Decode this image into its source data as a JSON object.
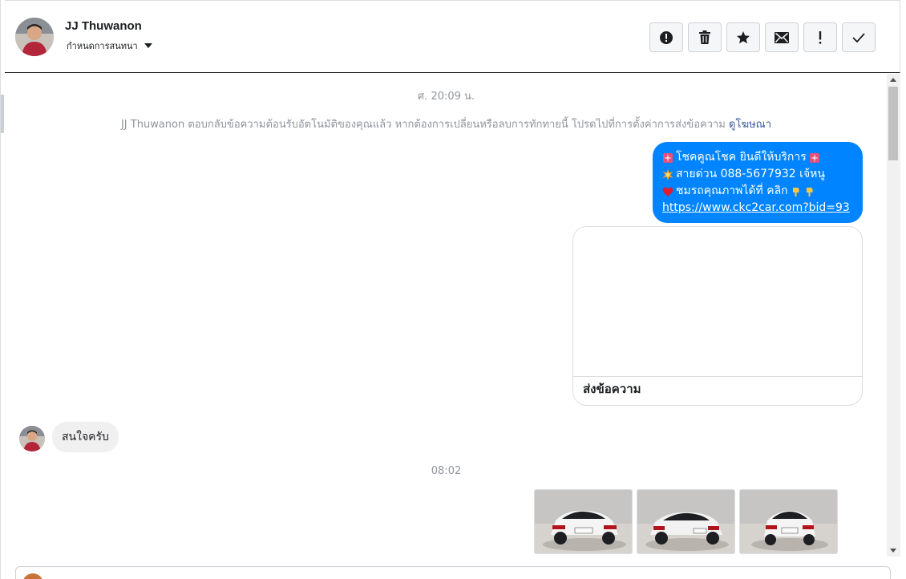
{
  "header": {
    "name": "JJ Thuwanon",
    "subtitle": "กำหนดการสนทนา"
  },
  "toolbar": {
    "buttons": [
      {
        "icon": "alert-circle-icon"
      },
      {
        "icon": "trash-icon"
      },
      {
        "icon": "star-icon"
      },
      {
        "icon": "envelope-icon"
      },
      {
        "icon": "exclamation-icon"
      },
      {
        "icon": "checkmark-icon"
      }
    ]
  },
  "messages": {
    "timestamp_1": "ศ. 20:09 น.",
    "notice_text": "JJ Thuwanon ตอบกลับข้อความต้อนรับอัตโนมัติของคุณแล้ว หากต้องการเปลี่ยนหรือลบการทักทายนี้ โปรดไปที่การตั้งค่าการส่งข้อความ",
    "notice_link": "ดูโฆษณา",
    "outgoing": {
      "line1": "โชคคูณโชค ยินดีให้บริการ",
      "line2": "สายด่วน 088-5677932 เจ้หนู",
      "line3": "ชมรถคุณภาพได้ที่   คลิก",
      "link": "https://www.ckc2car.com?bid=93"
    },
    "card_action": "ส่งข้อความ",
    "incoming_text": "สนใจครับ",
    "timestamp_2": "08:02"
  },
  "colors": {
    "outgoing_bubble": "#0084ff",
    "incoming_bubble": "#f1f0f0",
    "link": "#385898"
  }
}
